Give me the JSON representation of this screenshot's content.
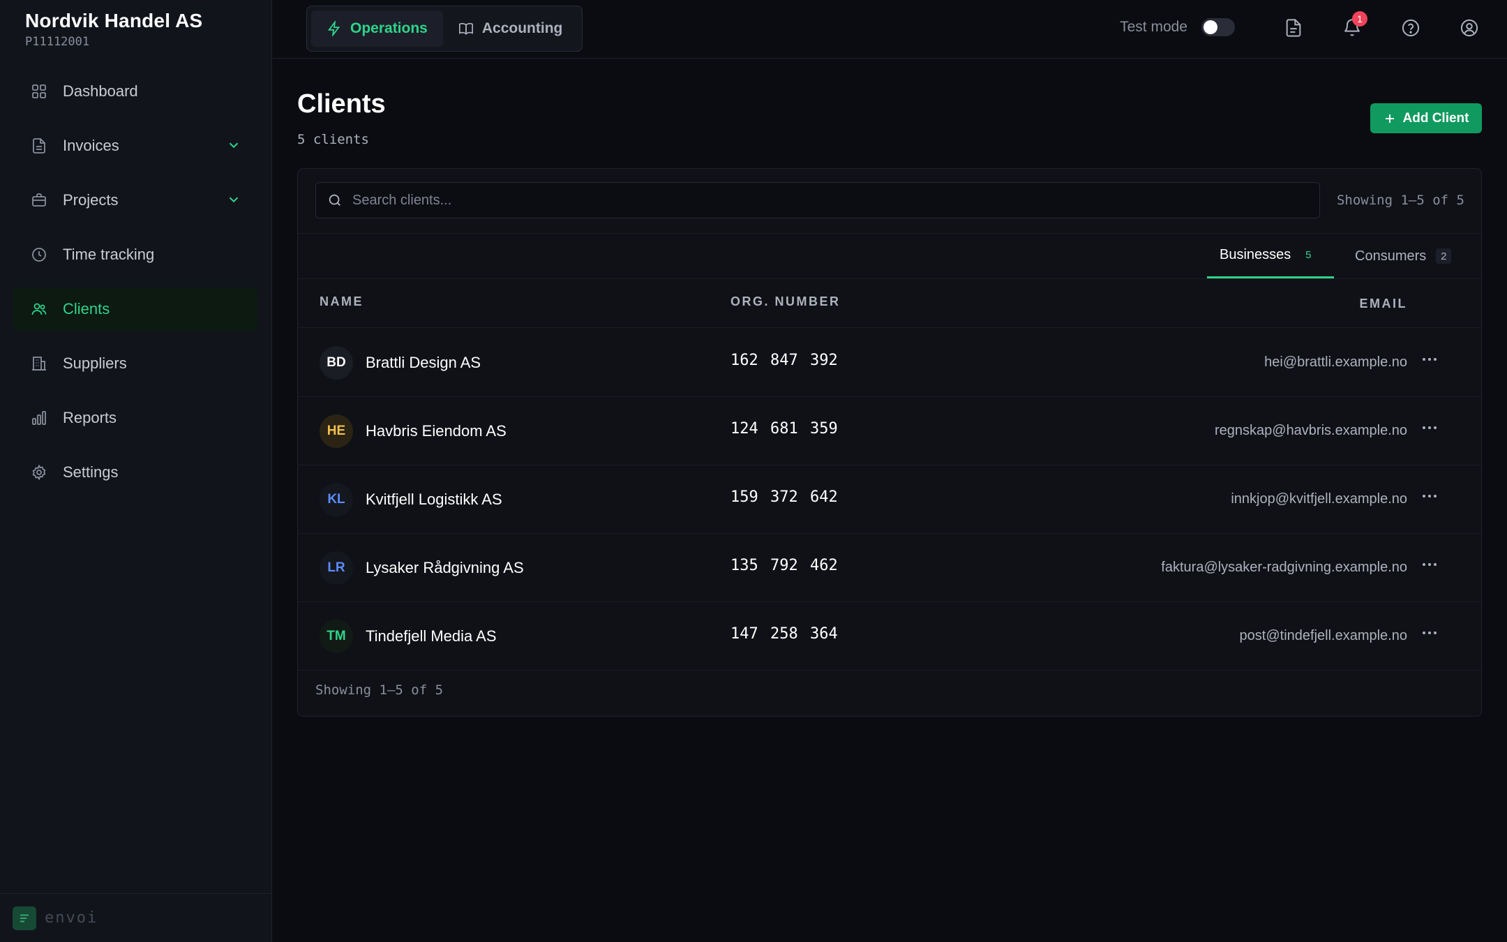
{
  "company": {
    "name": "Nordvik Handel AS",
    "id": "P11112001"
  },
  "sidebar": {
    "items": [
      {
        "label": "Dashboard",
        "icon": "grid-icon"
      },
      {
        "label": "Invoices",
        "icon": "document-icon",
        "expandable": true
      },
      {
        "label": "Projects",
        "icon": "briefcase-icon",
        "expandable": true
      },
      {
        "label": "Time tracking",
        "icon": "clock-icon"
      },
      {
        "label": "Clients",
        "icon": "users-icon",
        "active": true
      },
      {
        "label": "Suppliers",
        "icon": "building-icon"
      },
      {
        "label": "Reports",
        "icon": "bar-chart-icon"
      },
      {
        "label": "Settings",
        "icon": "gear-icon"
      }
    ],
    "footer_logo": "envoi"
  },
  "topbar": {
    "tabs": [
      {
        "label": "Operations",
        "icon": "lightning-icon",
        "active": true
      },
      {
        "label": "Accounting",
        "icon": "book-icon"
      }
    ],
    "test_mode_label": "Test mode",
    "test_mode_on": false,
    "notifications_count": "1"
  },
  "page": {
    "title": "Clients",
    "subtitle": "5 clients",
    "add_button": "Add Client"
  },
  "search": {
    "placeholder": "Search clients..."
  },
  "pagination": {
    "top": "Showing 1–5 of 5",
    "bottom": "Showing 1–5 of 5"
  },
  "segment_tabs": [
    {
      "label": "Businesses",
      "count": "5",
      "active": true
    },
    {
      "label": "Consumers",
      "count": "2"
    }
  ],
  "table": {
    "columns": {
      "name": "NAME",
      "org": "ORG. NUMBER",
      "email": "EMAIL"
    },
    "rows": [
      {
        "initials": "BD",
        "name": "Brattli Design AS",
        "org": "162 847 392",
        "email": "hei@brattli.example.no",
        "avatar_bg": "#1b1d25",
        "avatar_fg": "#ffffff"
      },
      {
        "initials": "HE",
        "name": "Havbris Eiendom AS",
        "org": "124 681 359",
        "email": "regnskap@havbris.example.no",
        "avatar_bg": "#2b2415",
        "avatar_fg": "#f2c14e"
      },
      {
        "initials": "KL",
        "name": "Kvitfjell Logistikk AS",
        "org": "159 372 642",
        "email": "innkjop@kvitfjell.example.no",
        "avatar_bg": "#15171f",
        "avatar_fg": "#5b8cff"
      },
      {
        "initials": "LR",
        "name": "Lysaker Rådgivning AS",
        "org": "135 792 462",
        "email": "faktura@lysaker-radgivning.example.no",
        "avatar_bg": "#15171f",
        "avatar_fg": "#5b8cff"
      },
      {
        "initials": "TM",
        "name": "Tindefjell Media AS",
        "org": "147 258 364",
        "email": "post@tindefjell.example.no",
        "avatar_bg": "#121a15",
        "avatar_fg": "#2fd38a"
      }
    ]
  },
  "colors": {
    "accent": "#2fd38a",
    "primary_button": "#109a5f",
    "badge": "#f0445b"
  }
}
